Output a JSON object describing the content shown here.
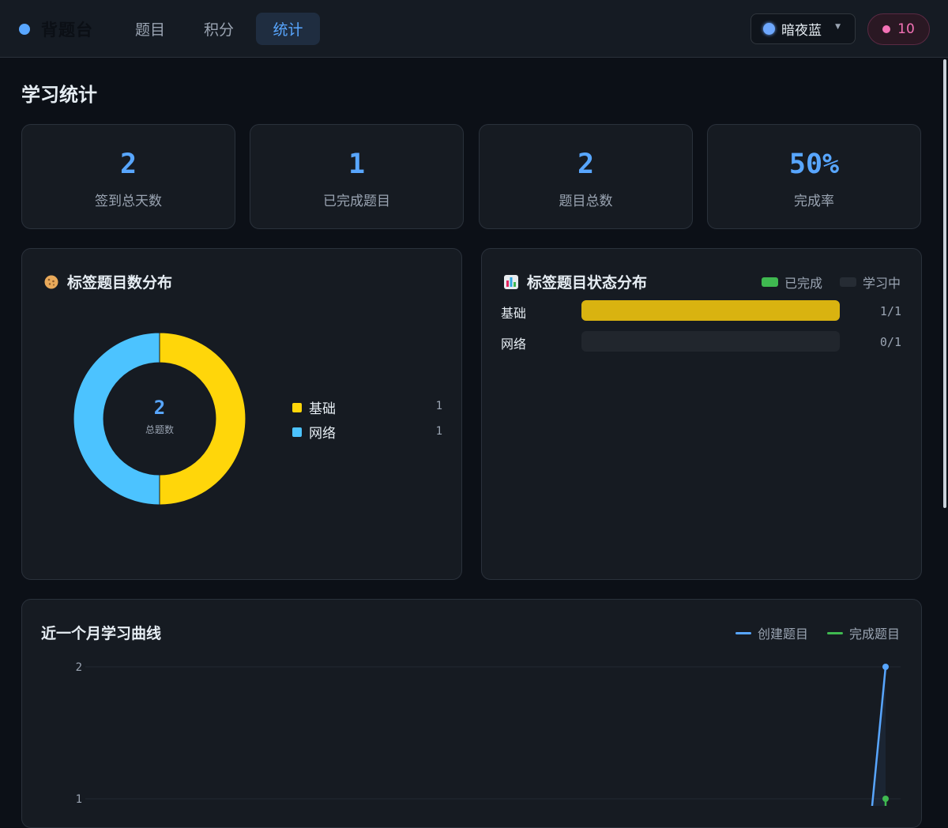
{
  "app": {
    "brand": "背题台",
    "nav": [
      "题目",
      "积分",
      "统计"
    ],
    "active_tab": "统计",
    "theme": "暗夜蓝",
    "points": "10"
  },
  "page": {
    "title": "学习统计"
  },
  "stats": [
    {
      "value": "2",
      "label": "签到总天数"
    },
    {
      "value": "1",
      "label": "已完成题目"
    },
    {
      "value": "2",
      "label": "题目总数"
    },
    {
      "value": "50%",
      "label": "完成率"
    }
  ],
  "tag_distribution": {
    "title": "标签题目数分布",
    "icon": "cookie-icon",
    "total_value": "2",
    "total_label": "总题数",
    "items": [
      {
        "name": "基础",
        "count": "1",
        "color": "#ffd60a"
      },
      {
        "name": "网络",
        "count": "1",
        "color": "#4cc3ff"
      }
    ]
  },
  "tag_status": {
    "title": "标签题目状态分布",
    "icon": "bar-chart-icon",
    "legend": [
      {
        "label": "已完成",
        "color": "#3fb950"
      },
      {
        "label": "学习中",
        "color": "#21262d"
      }
    ],
    "rows": [
      {
        "name": "基础",
        "done": 1,
        "total": 1,
        "count": "1/1"
      },
      {
        "name": "网络",
        "done": 0,
        "total": 1,
        "count": "0/1"
      }
    ]
  },
  "curve": {
    "title": "近一个月学习曲线",
    "legend": [
      {
        "label": "创建题目",
        "color": "#58a6ff"
      },
      {
        "label": "完成题目",
        "color": "#3fb950"
      }
    ],
    "y_ticks": [
      "2",
      "1"
    ]
  },
  "chart_data": [
    {
      "type": "pie",
      "categories": [
        "基础",
        "网络"
      ],
      "values": [
        1,
        1
      ],
      "colors": [
        "#ffd60a",
        "#4cc3ff"
      ]
    },
    {
      "type": "bar",
      "categories": [
        "基础",
        "网络"
      ],
      "values": [
        1,
        0
      ],
      "totals": [
        1,
        1
      ]
    },
    {
      "type": "line",
      "series": [
        {
          "name": "创建题目",
          "last_values": [
            0,
            2
          ]
        },
        {
          "name": "完成题目",
          "last_values": [
            1
          ]
        }
      ],
      "ylim": [
        1,
        2
      ]
    }
  ]
}
